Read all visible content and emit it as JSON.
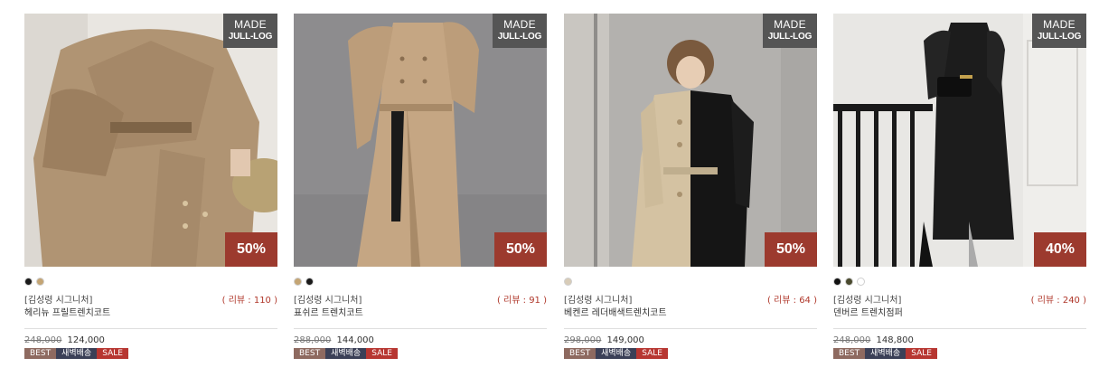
{
  "products": [
    {
      "made_line1": "MADE",
      "made_line2": "JULL-LOG",
      "discount": "50%",
      "swatches": [
        "#1a1a1a",
        "#c4a574"
      ],
      "brand": "[김성령 시그니처]",
      "reviews": "( 리뷰 : 110 )",
      "name": "헤리뉴 프릴트렌치코트",
      "price_original": "248,000",
      "price_sale": "124,000",
      "tags": [
        "BEST",
        "새벽배송",
        "SALE"
      ]
    },
    {
      "made_line1": "MADE",
      "made_line2": "JULL-LOG",
      "discount": "50%",
      "swatches": [
        "#c4a574",
        "#1a1a1a"
      ],
      "brand": "[김성령 시그니처]",
      "reviews": "( 리뷰 : 91 )",
      "name": "표쉬르 트렌치코트",
      "price_original": "288,000",
      "price_sale": "144,000",
      "tags": [
        "BEST",
        "새벽배송",
        "SALE"
      ]
    },
    {
      "made_line1": "MADE",
      "made_line2": "JULL-LOG",
      "discount": "50%",
      "swatches": [
        "#d8ccb8"
      ],
      "brand": "[김성령 시그니처]",
      "reviews": "( 리뷰 : 64 )",
      "name": "베켄르 레더배색트렌치코트",
      "price_original": "298,000",
      "price_sale": "149,000",
      "tags": [
        "BEST",
        "새벽배송",
        "SALE"
      ]
    },
    {
      "made_line1": "MADE",
      "made_line2": "JULL-LOG",
      "discount": "40%",
      "swatches": [
        "#111111",
        "#4a4a2e",
        "#ffffff"
      ],
      "brand": "[김성령 시그니처]",
      "reviews": "( 리뷰 : 240 )",
      "name": "덴버르 트렌치점퍼",
      "price_original": "248,000",
      "price_sale": "148,800",
      "tags": [
        "BEST",
        "새벽배송",
        "SALE"
      ]
    }
  ]
}
